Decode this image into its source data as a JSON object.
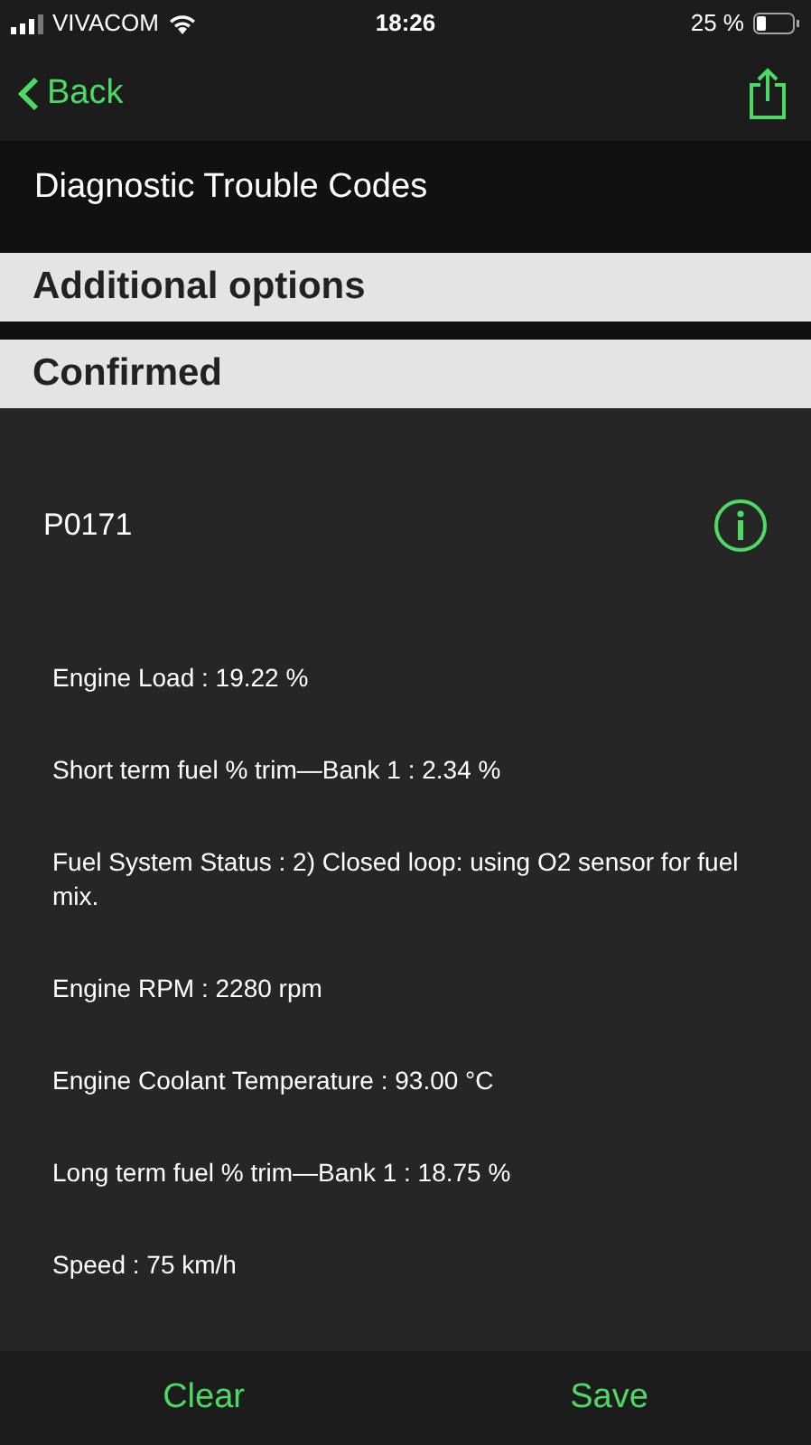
{
  "status_bar": {
    "carrier": "VIVACOM",
    "time": "18:26",
    "battery": "25 %"
  },
  "nav": {
    "back": "Back"
  },
  "title": "Diagnostic Trouble Codes",
  "sections": [
    {
      "label": "Additional options"
    },
    {
      "label": "Confirmed"
    }
  ],
  "code": "P0171",
  "details": [
    "Engine Load : 19.22 %",
    "Short term fuel % trim—Bank 1 : 2.34 %",
    "Fuel System Status : 2) Closed loop: using O2 sensor for fuel mix.",
    "Engine RPM : 2280 rpm",
    "Engine Coolant Temperature : 93.00 °C",
    "Long term fuel % trim—Bank 1 : 18.75 %",
    "Speed : 75 km/h"
  ],
  "toolbar": [
    "Clear",
    "Save"
  ]
}
